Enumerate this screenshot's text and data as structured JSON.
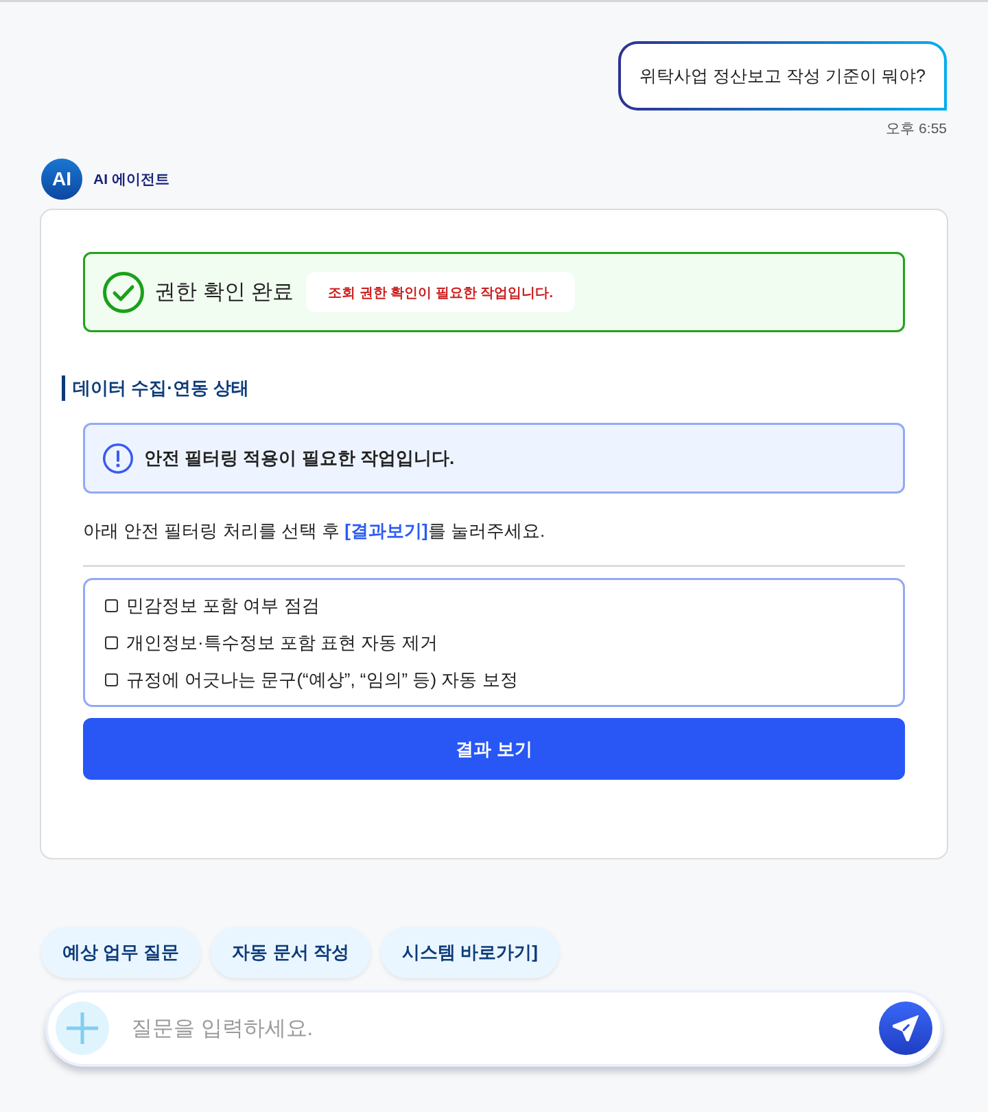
{
  "user_message": {
    "text": "위탁사업 정산보고 작성 기준이 뭐야?",
    "time": "오후 6:55"
  },
  "agent": {
    "avatar": "AI",
    "name": "AI 에이전트"
  },
  "response": {
    "permission": {
      "title": "권한 확인 완료",
      "note": "조회 권한 확인이 필요한 작업입니다."
    },
    "section_title": "데이터 수집·연동 상태",
    "alert": {
      "text": "안전 필터링 적용이 필요한 작업입니다."
    },
    "instruction": "아래 안전 필터링 처리를 선택 후 **[결과보기]**를 눌러주세요.",
    "options": [
      {
        "label": "민감정보 포함 여부 점검",
        "checked": false
      },
      {
        "label": "개인정보·특수정보 포함 표현 자동 제거",
        "checked": false
      },
      {
        "label": "규정에 어긋나는 문구(“예상”, “임의” 등) 자동 보정",
        "checked": false
      }
    ],
    "submit_button": "결과 보기"
  },
  "quick_replies": [
    "예상 업무 질문",
    "자동 문서 작성",
    "시스템 바로가기]"
  ],
  "composer": {
    "placeholder": "질문을 입력하세요."
  }
}
